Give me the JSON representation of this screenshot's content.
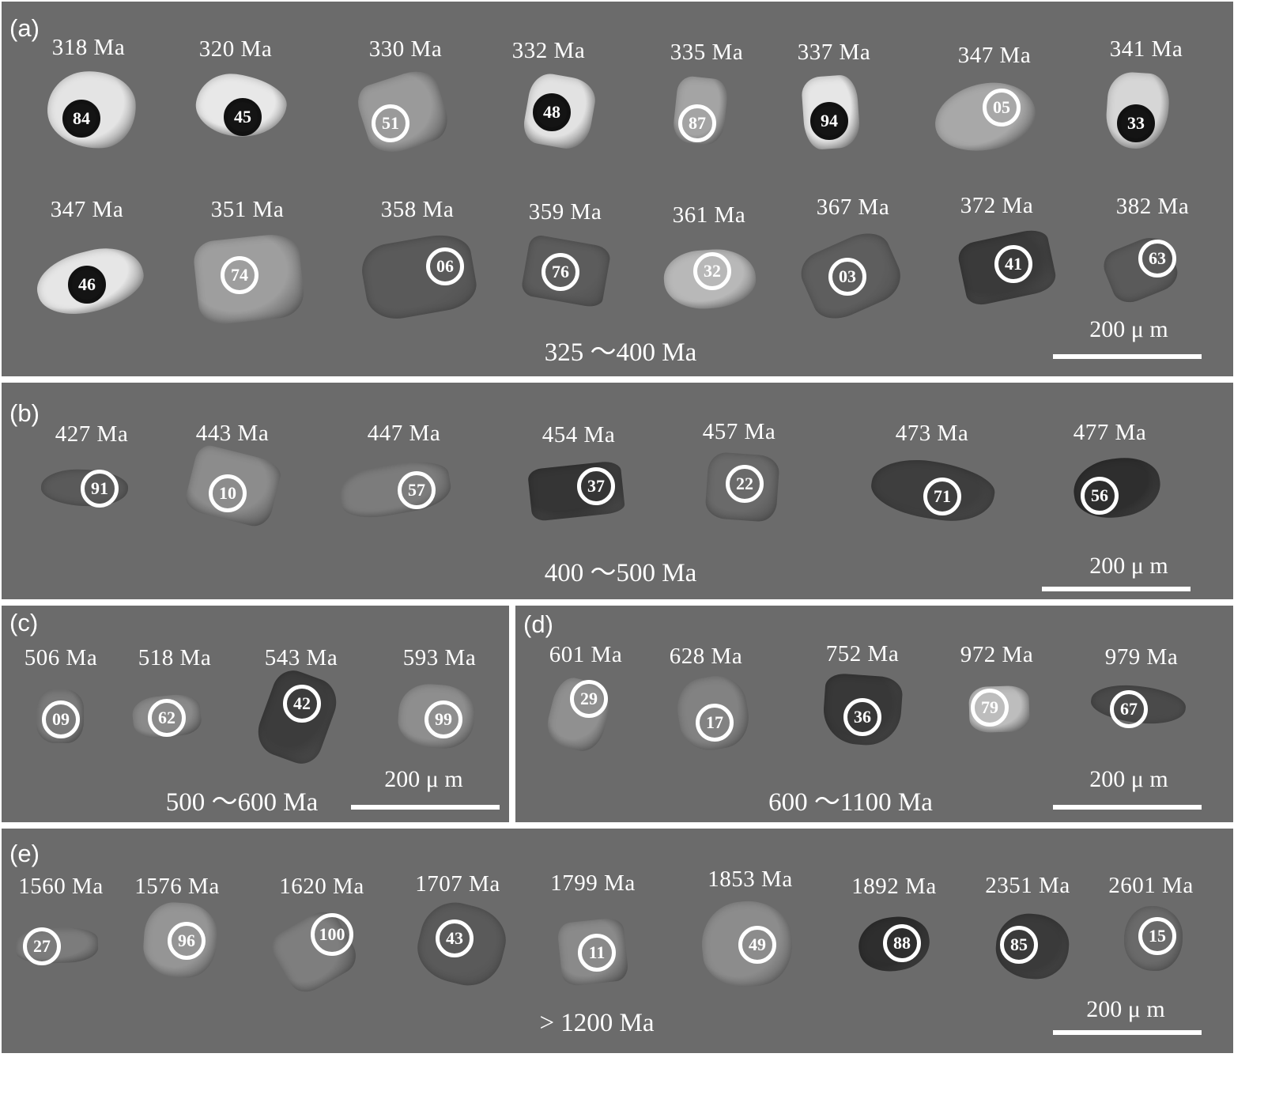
{
  "panels": {
    "a": {
      "label": "(a)",
      "range": "325 ～400 Ma",
      "scale": "200 μ m",
      "grains": [
        {
          "age": "318 Ma",
          "spot": "84",
          "spot_style": "dark",
          "tone": "#e4e4e4"
        },
        {
          "age": "320 Ma",
          "spot": "45",
          "spot_style": "dark",
          "tone": "#e8e8e8"
        },
        {
          "age": "330 Ma",
          "spot": "51",
          "spot_style": "light",
          "tone": "#9a9a9a"
        },
        {
          "age": "332 Ma",
          "spot": "48",
          "spot_style": "dark",
          "tone": "#e2e2e2"
        },
        {
          "age": "335 Ma",
          "spot": "87",
          "spot_style": "light",
          "tone": "#a4a4a4"
        },
        {
          "age": "337 Ma",
          "spot": "94",
          "spot_style": "dark",
          "tone": "#e6e6e6"
        },
        {
          "age": "347 Ma",
          "spot": "05",
          "spot_style": "light",
          "tone": "#a8a8a8"
        },
        {
          "age": "341 Ma",
          "spot": "33",
          "spot_style": "dark",
          "tone": "#d6d6d6"
        },
        {
          "age": "347 Ma",
          "spot": "46",
          "spot_style": "dark",
          "tone": "#e6e6e6"
        },
        {
          "age": "351 Ma",
          "spot": "74",
          "spot_style": "light",
          "tone": "#9e9e9e"
        },
        {
          "age": "358 Ma",
          "spot": "06",
          "spot_style": "light",
          "tone": "#5a5a5a"
        },
        {
          "age": "359 Ma",
          "spot": "76",
          "spot_style": "light",
          "tone": "#5c5c5c"
        },
        {
          "age": "361 Ma",
          "spot": "32",
          "spot_style": "light",
          "tone": "#b8b8b8"
        },
        {
          "age": "367 Ma",
          "spot": "03",
          "spot_style": "light",
          "tone": "#5e5e5e"
        },
        {
          "age": "372 Ma",
          "spot": "41",
          "spot_style": "light",
          "tone": "#3a3a3a"
        },
        {
          "age": "382 Ma",
          "spot": "63",
          "spot_style": "light",
          "tone": "#5a5a5a"
        }
      ]
    },
    "b": {
      "label": "(b)",
      "range": "400 ～500 Ma",
      "scale": "200 μ m",
      "grains": [
        {
          "age": "427 Ma",
          "spot": "91",
          "spot_style": "light",
          "tone": "#5a5a5a"
        },
        {
          "age": "443 Ma",
          "spot": "10",
          "spot_style": "light",
          "tone": "#8c8c8c"
        },
        {
          "age": "447 Ma",
          "spot": "57",
          "spot_style": "light",
          "tone": "#7c7c7c"
        },
        {
          "age": "454 Ma",
          "spot": "37",
          "spot_style": "light",
          "tone": "#353535"
        },
        {
          "age": "457 Ma",
          "spot": "22",
          "spot_style": "light",
          "tone": "#6a6a6a"
        },
        {
          "age": "473 Ma",
          "spot": "71",
          "spot_style": "light",
          "tone": "#3e3e3e"
        },
        {
          "age": "477 Ma",
          "spot": "56",
          "spot_style": "light",
          "tone": "#2e2e2e"
        }
      ]
    },
    "c": {
      "label": "(c)",
      "range": "500 ～600 Ma",
      "scale": "200 μ m",
      "grains": [
        {
          "age": "506 Ma",
          "spot": "09",
          "spot_style": "light",
          "tone": "#7a7a7a"
        },
        {
          "age": "518 Ma",
          "spot": "62",
          "spot_style": "light",
          "tone": "#8a8a8a"
        },
        {
          "age": "543 Ma",
          "spot": "42",
          "spot_style": "light",
          "tone": "#3c3c3c"
        },
        {
          "age": "593 Ma",
          "spot": "99",
          "spot_style": "light",
          "tone": "#8e8e8e"
        }
      ]
    },
    "d": {
      "label": "(d)",
      "range": "600 ～1100 Ma",
      "scale": "200 μ m",
      "grains": [
        {
          "age": "601 Ma",
          "spot": "29",
          "spot_style": "light",
          "tone": "#909090"
        },
        {
          "age": "628 Ma",
          "spot": "17",
          "spot_style": "light",
          "tone": "#828282"
        },
        {
          "age": "752 Ma",
          "spot": "36",
          "spot_style": "light",
          "tone": "#383838"
        },
        {
          "age": "972 Ma",
          "spot": "79",
          "spot_style": "light",
          "tone": "#bdbdbd"
        },
        {
          "age": "979  Ma",
          "spot": "67",
          "spot_style": "light",
          "tone": "#4a4a4a"
        }
      ]
    },
    "e": {
      "label": "(e)",
      "range": "> 1200 Ma",
      "scale": "200 μ m",
      "grains": [
        {
          "age": "1560 Ma",
          "spot": "27",
          "spot_style": "light",
          "tone": "#7c7c7c"
        },
        {
          "age": "1576 Ma",
          "spot": "96",
          "spot_style": "light",
          "tone": "#959595"
        },
        {
          "age": "1620 Ma",
          "spot": "100",
          "spot_style": "light",
          "tone": "#7e7e7e"
        },
        {
          "age": "1707 Ma",
          "spot": "43",
          "spot_style": "light",
          "tone": "#5a5a5a"
        },
        {
          "age": "1799 Ma",
          "spot": "11",
          "spot_style": "light",
          "tone": "#8a8a8a"
        },
        {
          "age": "1853 Ma",
          "spot": "49",
          "spot_style": "light",
          "tone": "#8c8c8c"
        },
        {
          "age": "1892 Ma",
          "spot": "88",
          "spot_style": "light",
          "tone": "#2e2e2e"
        },
        {
          "age": "2351 Ma",
          "spot": "85",
          "spot_style": "light",
          "tone": "#3a3a3a"
        },
        {
          "age": "2601 Ma",
          "spot": "15",
          "spot_style": "light",
          "tone": "#6a6a6a"
        }
      ]
    }
  }
}
